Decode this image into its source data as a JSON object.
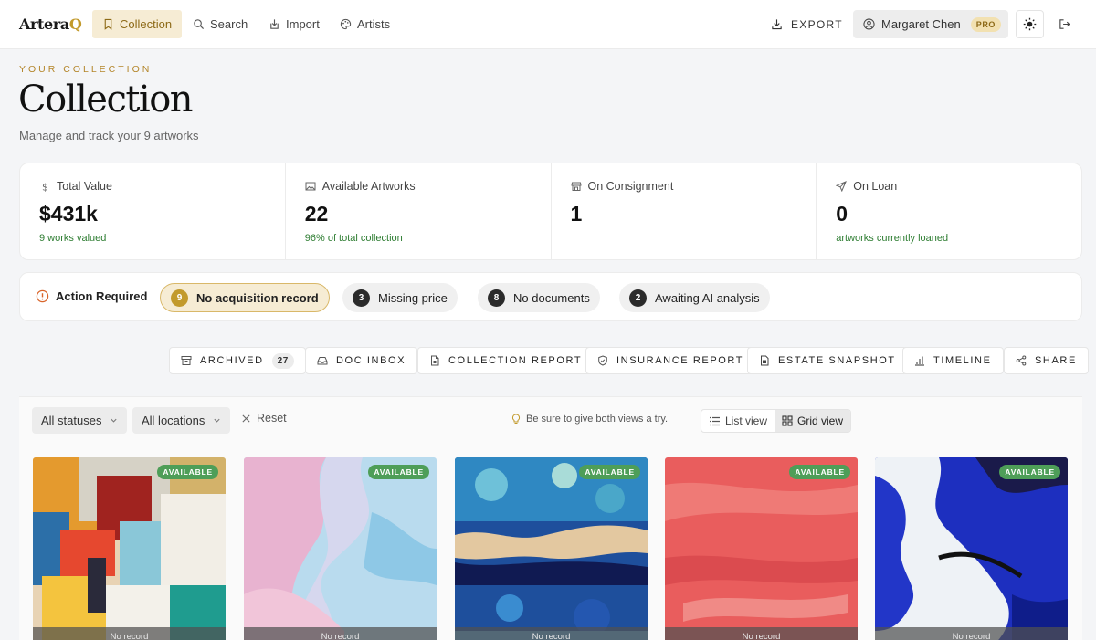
{
  "app": {
    "logo_main": "Artera",
    "logo_accent": "Q"
  },
  "nav": {
    "items": [
      {
        "label": "Collection",
        "icon": "bookmark-icon",
        "active": true
      },
      {
        "label": "Search",
        "icon": "search-icon"
      },
      {
        "label": "Import",
        "icon": "import-icon"
      },
      {
        "label": "Artists",
        "icon": "palette-icon"
      }
    ],
    "export_label": "EXPORT",
    "user": {
      "name": "Margaret Chen",
      "plan": "PRO"
    }
  },
  "header": {
    "eyebrow": "YOUR COLLECTION",
    "title": "Collection",
    "subtitle": "Manage and track your 9 artworks"
  },
  "stats": [
    {
      "label": "Total Value",
      "icon": "dollar-icon",
      "value": "$431k",
      "note": "9 works valued"
    },
    {
      "label": "Available Artworks",
      "icon": "image-icon",
      "value": "22",
      "note": "96% of total collection"
    },
    {
      "label": "On Consignment",
      "icon": "store-icon",
      "value": "1",
      "note": ""
    },
    {
      "label": "On Loan",
      "icon": "send-icon",
      "value": "0",
      "note": "artworks currently loaned"
    }
  ],
  "action_required": {
    "label": "Action Required",
    "pills": [
      {
        "count": "9",
        "label": "No acquisition record",
        "active": true
      },
      {
        "count": "3",
        "label": "Missing price"
      },
      {
        "count": "8",
        "label": "No documents"
      },
      {
        "count": "2",
        "label": "Awaiting AI analysis"
      }
    ]
  },
  "toolbar": {
    "archived_label": "ARCHIVED",
    "archived_count": "27",
    "doc_inbox": "DOC INBOX",
    "collection_report": "COLLECTION REPORT",
    "insurance_report": "INSURANCE REPORT",
    "estate_snapshot": "ESTATE SNAPSHOT",
    "timeline": "TIMELINE",
    "share": "SHARE"
  },
  "filters": {
    "status": "All statuses",
    "location": "All locations",
    "reset": "Reset",
    "tip": "Be sure to give both views a try.",
    "list_view": "List view",
    "grid_view": "Grid view",
    "active_view": "grid"
  },
  "artworks": [
    {
      "status": "AVAILABLE",
      "footer": "No record"
    },
    {
      "status": "AVAILABLE",
      "footer": "No record"
    },
    {
      "status": "AVAILABLE",
      "footer": "No record"
    },
    {
      "status": "AVAILABLE",
      "footer": "No record"
    },
    {
      "status": "AVAILABLE",
      "footer": "No record"
    }
  ],
  "colors": {
    "accent": "#c29a2c",
    "accent_bg": "#f6ecd4",
    "success": "#2e7d32",
    "status_available": "#4e9e58"
  }
}
